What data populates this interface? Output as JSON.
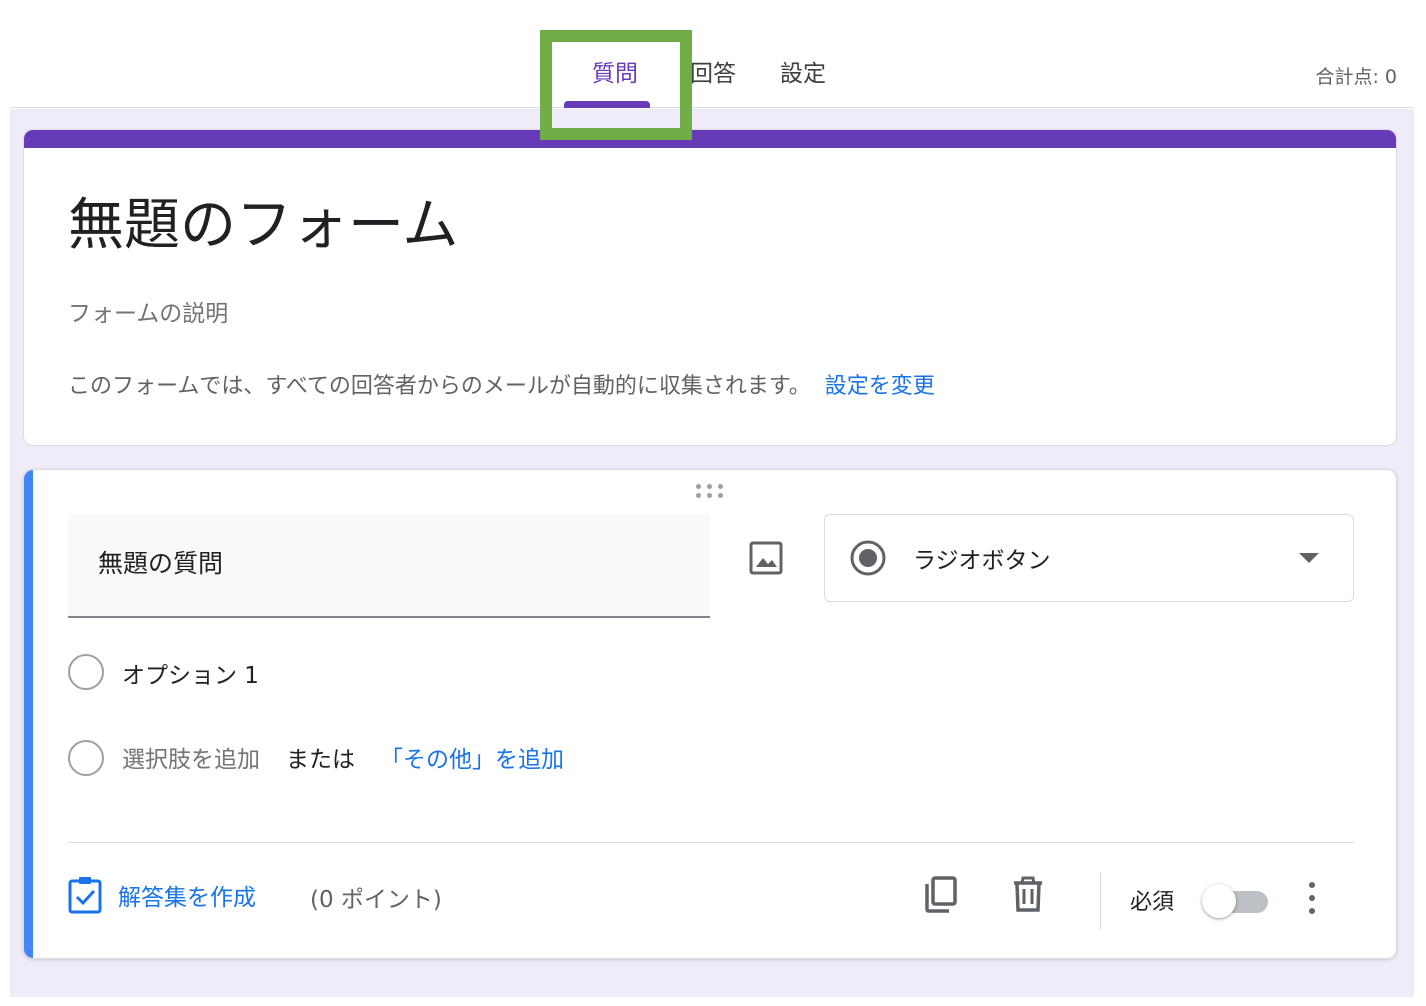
{
  "tabs": [
    {
      "label": "質問",
      "active": true
    },
    {
      "label": "回答",
      "active": false
    },
    {
      "label": "設定",
      "active": false
    }
  ],
  "total_score": "合計点: 0",
  "form": {
    "title": "無題のフォーム",
    "description": "フォームの説明",
    "email_note": "このフォームでは、すべての回答者からのメールが自動的に収集されます。",
    "email_change_link": "設定を変更"
  },
  "question": {
    "title": "無題の質問",
    "type_label": "ラジオボタン",
    "options": [
      "オプション 1"
    ],
    "add_option": "選択肢を追加",
    "or_text": "または",
    "add_other": "「その他」を追加",
    "answer_key": "解答集を作成",
    "points": "(0 ポイント)",
    "required_label": "必須",
    "required": false
  },
  "icons": {
    "image": "image-icon",
    "radio": "radio-button-icon",
    "copy": "copy-icon",
    "delete": "trash-icon",
    "more": "more-vert-icon",
    "answer_key": "checkbox-clipboard-icon",
    "drag": "drag-handle-icon"
  },
  "colors": {
    "accent": "#673ab7",
    "link": "#1a73e8",
    "question_bar": "#4285f4",
    "highlight": "#70ad47",
    "canvas": "#f0ebf8"
  }
}
